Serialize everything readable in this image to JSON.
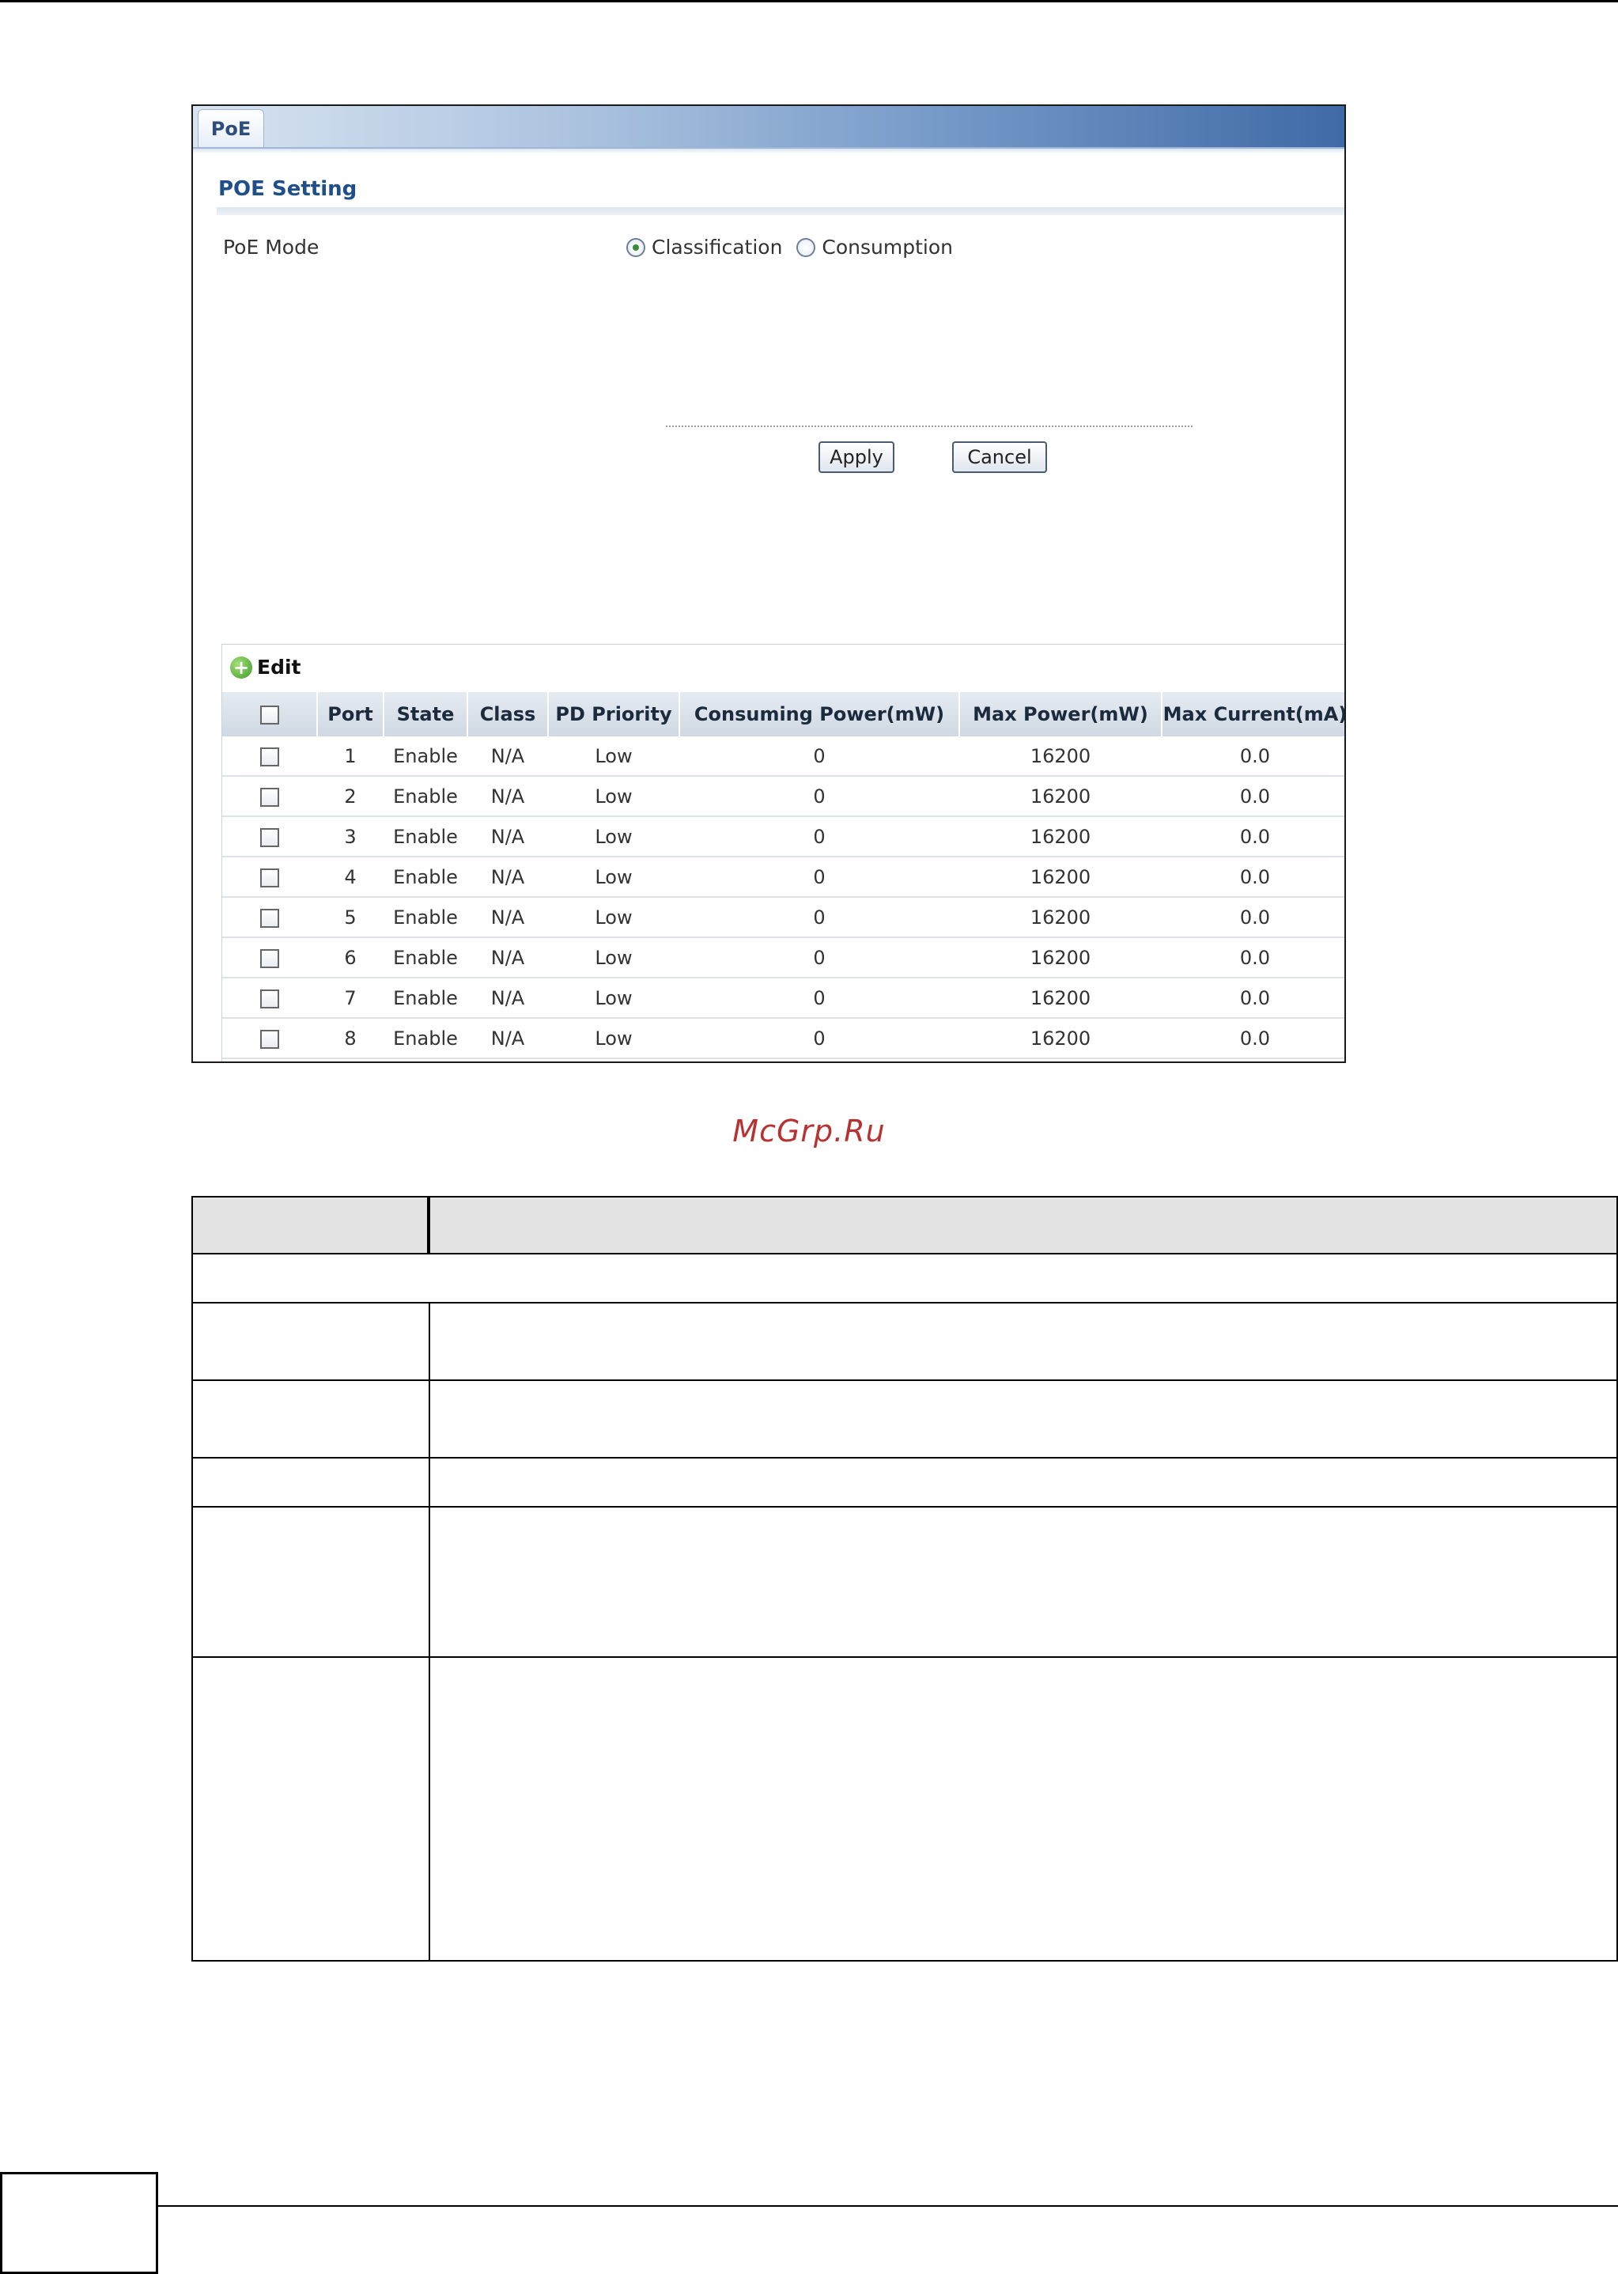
{
  "tabs": [
    {
      "label": "PoE"
    }
  ],
  "section_title": "POE Setting",
  "poe_mode": {
    "label": "PoE Mode",
    "options": [
      {
        "label": "Classification",
        "checked": true
      },
      {
        "label": "Consumption",
        "checked": false
      }
    ]
  },
  "buttons": {
    "apply": "Apply",
    "cancel": "Cancel"
  },
  "table": {
    "edit_label": "Edit",
    "columns": [
      "Port",
      "State",
      "Class",
      "PD Priority",
      "Consuming Power(mW)",
      "Max Power(mW)",
      "Max Current(mA)"
    ],
    "rows": [
      {
        "port": "1",
        "state": "Enable",
        "class": "N/A",
        "priority": "Low",
        "consuming": "0",
        "max_power": "16200",
        "max_current": "0.0"
      },
      {
        "port": "2",
        "state": "Enable",
        "class": "N/A",
        "priority": "Low",
        "consuming": "0",
        "max_power": "16200",
        "max_current": "0.0"
      },
      {
        "port": "3",
        "state": "Enable",
        "class": "N/A",
        "priority": "Low",
        "consuming": "0",
        "max_power": "16200",
        "max_current": "0.0"
      },
      {
        "port": "4",
        "state": "Enable",
        "class": "N/A",
        "priority": "Low",
        "consuming": "0",
        "max_power": "16200",
        "max_current": "0.0"
      },
      {
        "port": "5",
        "state": "Enable",
        "class": "N/A",
        "priority": "Low",
        "consuming": "0",
        "max_power": "16200",
        "max_current": "0.0"
      },
      {
        "port": "6",
        "state": "Enable",
        "class": "N/A",
        "priority": "Low",
        "consuming": "0",
        "max_power": "16200",
        "max_current": "0.0"
      },
      {
        "port": "7",
        "state": "Enable",
        "class": "N/A",
        "priority": "Low",
        "consuming": "0",
        "max_power": "16200",
        "max_current": "0.0"
      },
      {
        "port": "8",
        "state": "Enable",
        "class": "N/A",
        "priority": "Low",
        "consuming": "0",
        "max_power": "16200",
        "max_current": "0.0"
      }
    ]
  },
  "watermark": "McGrp.Ru",
  "icons": {
    "add": "plus-circle-icon"
  },
  "colors": {
    "section_title": "#1e4f8a",
    "watermark": "#b83232",
    "edit_icon": "#3c9a2a"
  }
}
